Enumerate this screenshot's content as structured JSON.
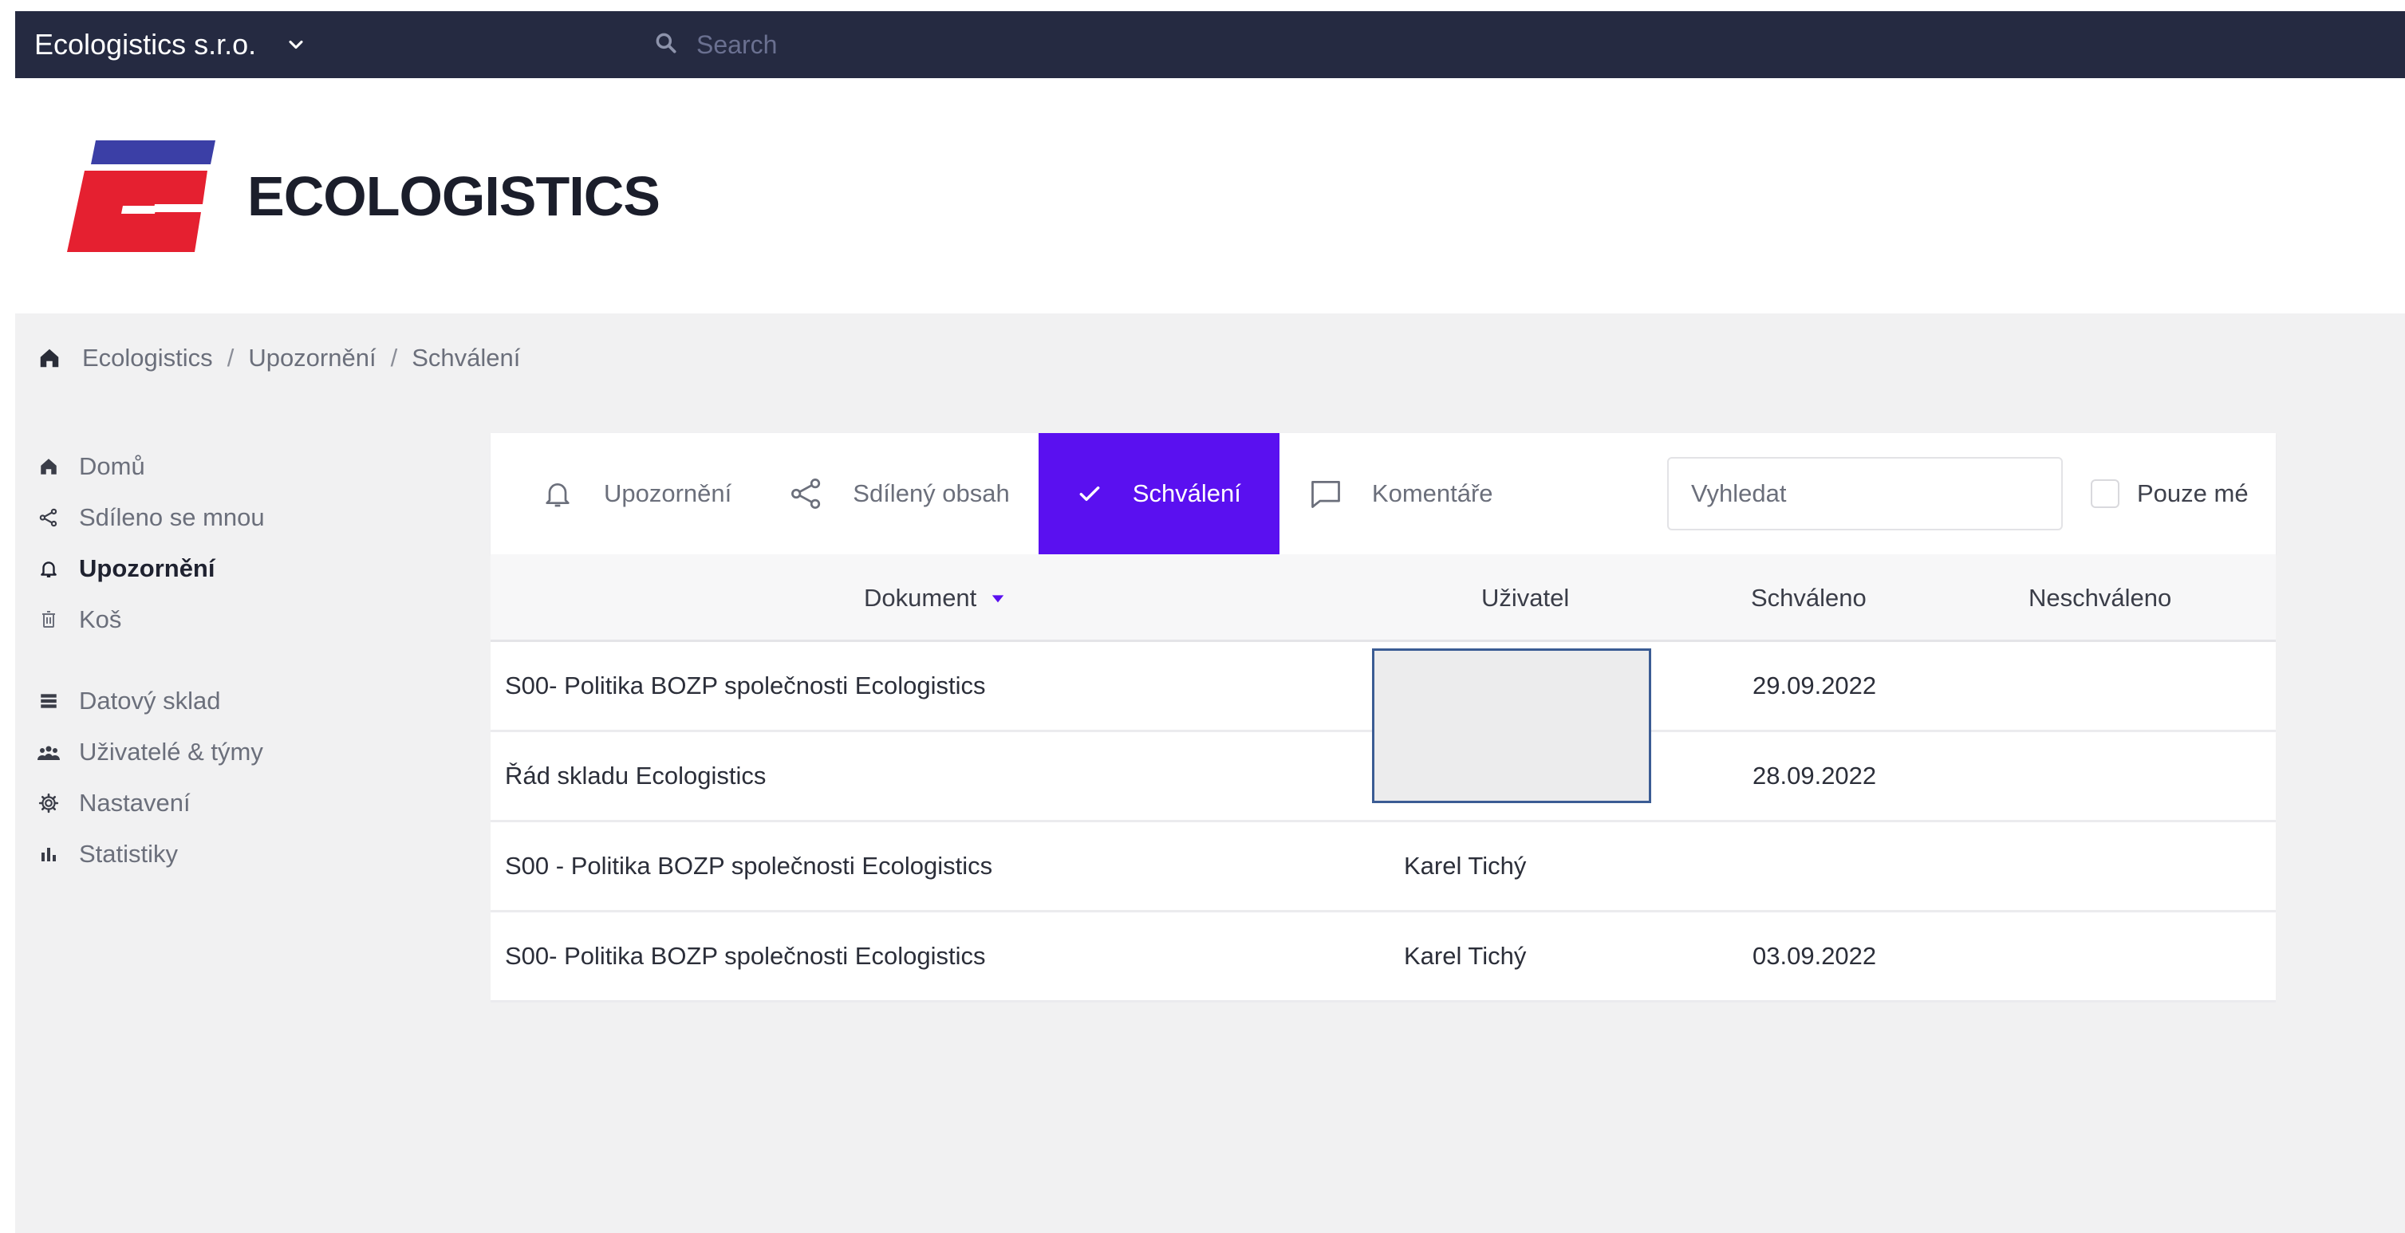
{
  "topbar": {
    "org_name": "Ecologistics s.r.o.",
    "search_placeholder": "Search",
    "bg_color": "#252a41"
  },
  "brand": {
    "name": "ECOLOGISTICS",
    "colors": {
      "blue": "#3b3fa6",
      "red": "#e52030"
    }
  },
  "breadcrumb": [
    "Ecologistics",
    "Upozornění",
    "Schválení"
  ],
  "sidebar": {
    "items": [
      {
        "label": "Domů",
        "icon": "home-icon"
      },
      {
        "label": "Sdíleno se mnou",
        "icon": "share-icon"
      },
      {
        "label": "Upozornění",
        "icon": "bell-icon",
        "active": true
      },
      {
        "label": "Koš",
        "icon": "trash-icon"
      }
    ],
    "items2": [
      {
        "label": "Datový sklad",
        "icon": "list-icon"
      },
      {
        "label": "Uživatelé & týmy",
        "icon": "users-icon"
      },
      {
        "label": "Nastavení",
        "icon": "gear-icon"
      },
      {
        "label": "Statistiky",
        "icon": "bar-chart-icon"
      }
    ]
  },
  "tabs": [
    {
      "label": "Upozornění",
      "icon": "bell-icon"
    },
    {
      "label": "Sdílený obsah",
      "icon": "share-icon"
    },
    {
      "label": "Schválení",
      "icon": "check-icon",
      "active": true
    },
    {
      "label": "Komentáře",
      "icon": "comment-icon"
    }
  ],
  "accent_color": "#5a10f0",
  "filter": {
    "search_placeholder": "Vyhledat",
    "only_mine_label": "Pouze mé"
  },
  "table": {
    "columns": [
      "Dokument",
      "Uživatel",
      "Schváleno",
      "Neschváleno"
    ],
    "rows": [
      {
        "document": "S00- Politika BOZP společnosti Ecologistics",
        "user": "",
        "approved": "29.09.2022",
        "rejected": ""
      },
      {
        "document": "Řád skladu Ecologistics",
        "user": "",
        "approved": "28.09.2022",
        "rejected": ""
      },
      {
        "document": "S00 - Politika BOZP společnosti Ecologistics",
        "user": "Karel Tichý",
        "approved": "",
        "rejected": ""
      },
      {
        "document": "S00- Politika BOZP společnosti Ecologistics",
        "user": "Karel Tichý",
        "approved": "03.09.2022",
        "rejected": ""
      }
    ]
  }
}
